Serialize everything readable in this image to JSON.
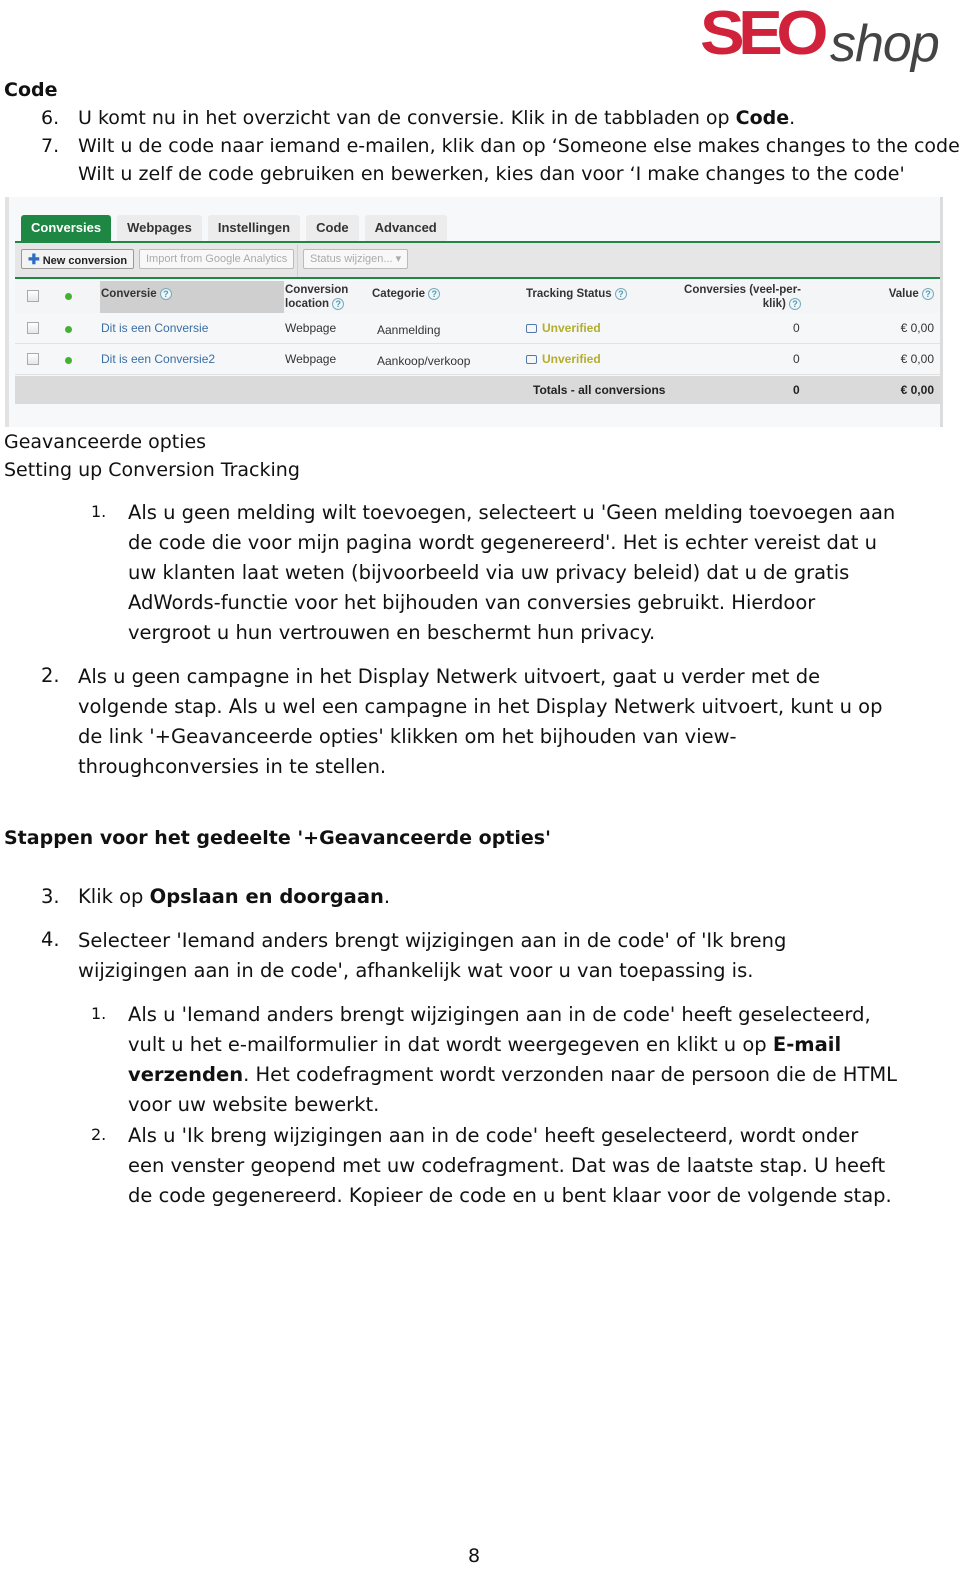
{
  "logo": {
    "part1": "SEO",
    "part2": "shop",
    "colors": {
      "seo": "#d0223a",
      "shop": "#444444"
    }
  },
  "section_code": {
    "heading": "Code",
    "items": [
      {
        "num": "6.",
        "text_before": "U komt nu in het overzicht van de conversie. Klik in de tabbladen op ",
        "bold": "Code",
        "text_after": "."
      },
      {
        "num": "7.",
        "line1": "Wilt u de code naar iemand e-mailen, klik dan op ‘Someone else makes changes to the code’.",
        "line2": "Wilt u zelf de code gebruiken en bewerken, kies dan voor  ‘I make changes to the code'"
      }
    ]
  },
  "screenshot": {
    "tabs": [
      "Conversies",
      "Webpages",
      "Instellingen",
      "Code",
      "Advanced"
    ],
    "active_tab": "Conversies",
    "toolbar": {
      "new_conversion": "New conversion",
      "import": "Import from Google Analytics",
      "status": "Status wijzigen...",
      "status_arrow": "▾",
      "plus_icon": "✚"
    },
    "columns": {
      "conversie": "Conversie",
      "location_line1": "Conversion",
      "location_line2": "location",
      "categorie": "Categorie",
      "tracking_status": "Tracking Status",
      "conversies_line1": "Conversies (veel-per-",
      "conversies_line2": "klik)",
      "value": "Value",
      "help": "?"
    },
    "rows": [
      {
        "name": "Dit is een Conversie",
        "location": "Webpage",
        "category": "Aanmelding",
        "status": "Unverified",
        "conversions": "0",
        "value": "€ 0,00"
      },
      {
        "name": "Dit is een Conversie2",
        "location": "Webpage",
        "category": "Aankoop/verkoop",
        "status": "Unverified",
        "conversions": "0",
        "value": "€ 0,00"
      }
    ],
    "totals": {
      "label": "Totals - all conversions",
      "conversions": "0",
      "value": "€ 0,00"
    },
    "colors": {
      "accent": "#1e8743",
      "link": "#3a6ea5",
      "unverified": "#b3ae2d",
      "active_dot": "#44b034"
    }
  },
  "section_advanced": {
    "heading1": "Geavanceerde opties",
    "heading2": "Setting up Conversion Tracking",
    "sub1": {
      "num": "1.",
      "lines": [
        "Als u geen melding wilt toevoegen, selecteert u 'Geen melding toevoegen aan",
        "de code die voor mijn pagina wordt gegenereerd'. Het is echter vereist dat u",
        "uw klanten laat weten (bijvoorbeeld via uw privacy beleid) dat u de gratis",
        "AdWords-functie voor het bijhouden van conversies gebruikt. Hierdoor",
        "vergroot u hun vertrouwen en beschermt hun privacy."
      ]
    },
    "item2": {
      "num": "2.",
      "lines": [
        "Als u geen campagne in het Display Netwerk uitvoert, gaat u verder met de",
        "volgende stap. Als u wel een campagne in het Display Netwerk uitvoert, kunt u op",
        "de link '+Geavanceerde opties' klikken om het bijhouden van view-",
        "throughconversies in te stellen."
      ]
    }
  },
  "section_steps": {
    "heading": "Stappen voor het gedeelte '+Geavanceerde opties'",
    "item3": {
      "num": "3.",
      "text": "Klik op ",
      "bold": "Opslaan en doorgaan",
      "after": "."
    },
    "item4": {
      "num": "4.",
      "lines": [
        "Selecteer 'Iemand anders brengt wijzigingen aan in de code' of 'Ik breng",
        "wijzigingen aan in de code', afhankelijk wat voor u van toepassing is."
      ]
    },
    "sub1": {
      "num": "1.",
      "line1": "Als u 'Iemand anders brengt wijzigingen aan in de code' heeft geselecteerd,",
      "line2_before": "vult u het e-mailformulier in dat wordt weergegeven en klikt u op ",
      "line2_bold": "E-mail",
      "line3_bold": "verzenden",
      "line3_after": ". Het codefragment wordt verzonden naar de persoon die de HTML",
      "line4": "voor uw website bewerkt."
    },
    "sub2": {
      "num": "2.",
      "lines": [
        "Als u 'Ik breng wijzigingen aan in de code' heeft geselecteerd, wordt onder",
        "een venster geopend met uw codefragment. Dat was de laatste stap. U heeft",
        "de code gegenereerd. Kopieer de code en u bent klaar voor de volgende stap."
      ]
    }
  },
  "page_number": "8"
}
